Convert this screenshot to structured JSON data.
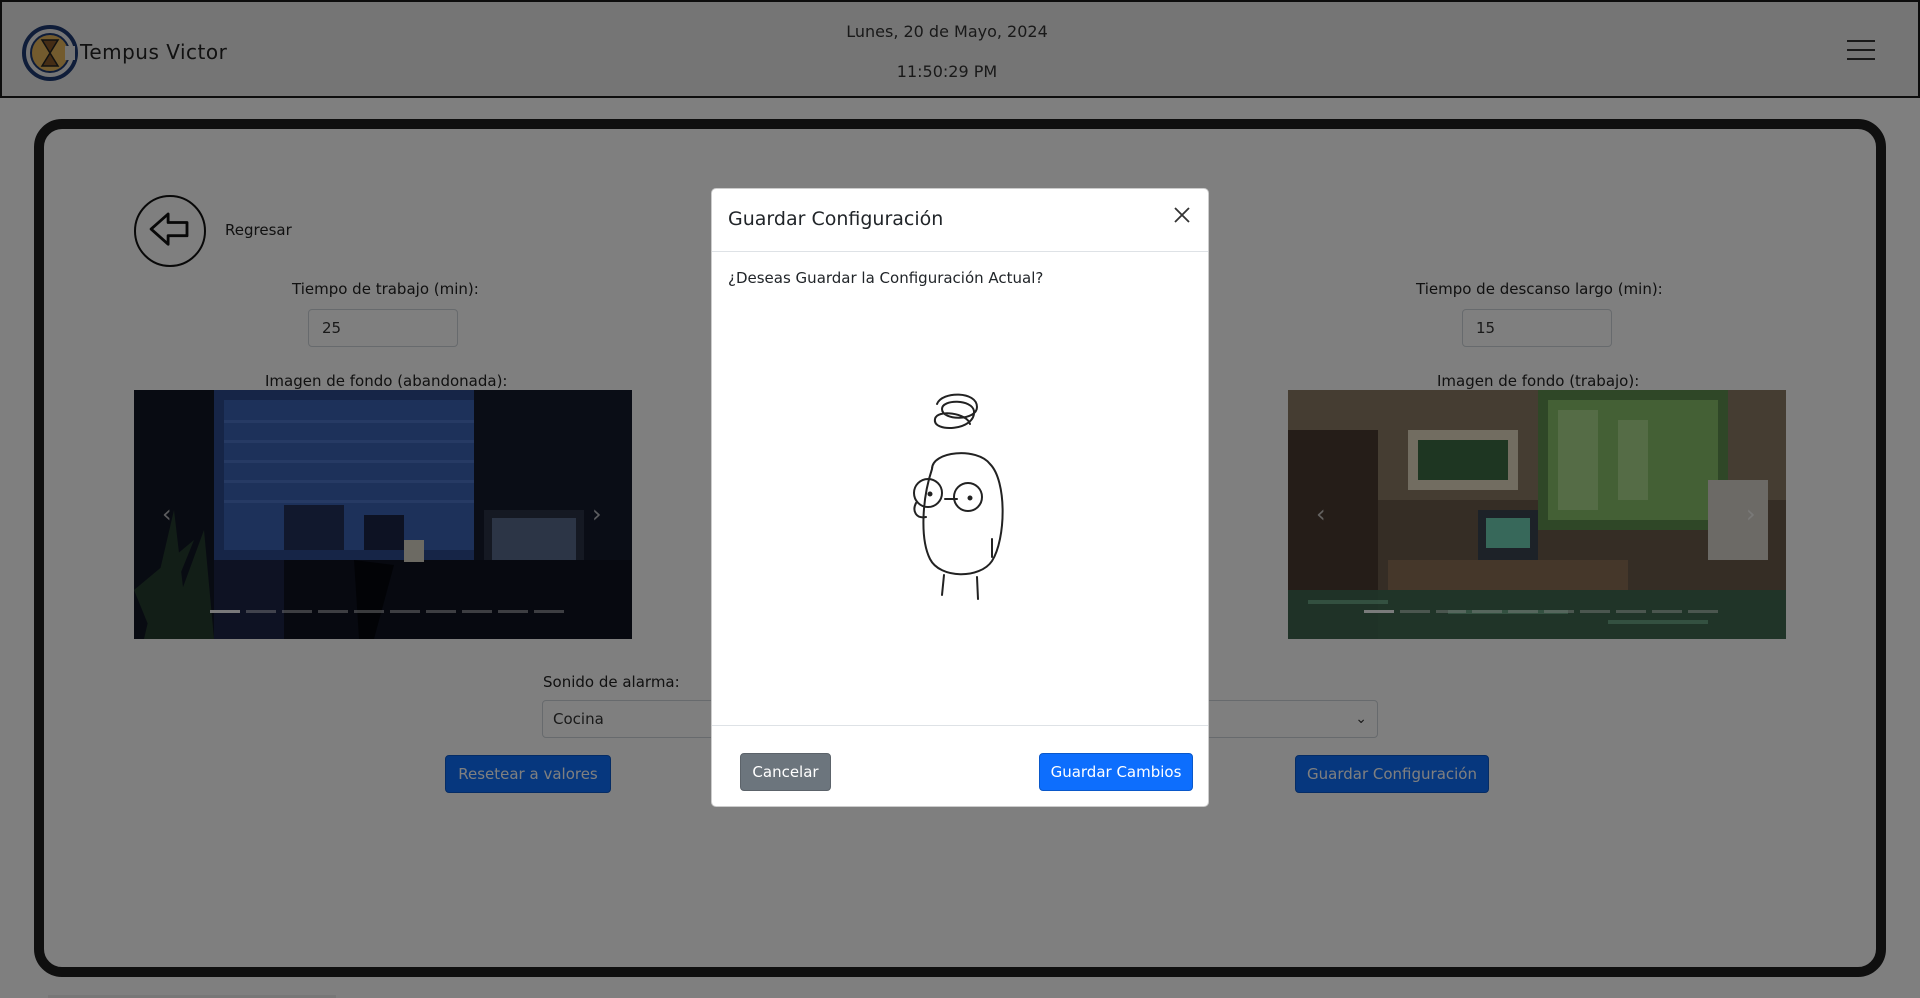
{
  "header": {
    "brand": "Tempus Victor",
    "date": "Lunes, 20 de Mayo, 2024",
    "time": "11:50:29 PM",
    "icons": {
      "logo": "hourglass-clock-logo",
      "menu": "hamburger-menu-icon"
    }
  },
  "settings": {
    "back_label": "Regresar",
    "work_time_label": "Tiempo de trabajo (min):",
    "work_time_value": "25",
    "long_break_label": "Tiempo de descanso largo (min):",
    "long_break_value": "15",
    "bg_abandoned_label": "Imagen de fondo (abandonada):",
    "bg_work_label": "Imagen de fondo (trabajo):",
    "alarm_label": "Sonido de alarma:",
    "alarm_value": "Cocina",
    "reset_button": "Resetear a valores",
    "save_config_button": "Guardar Configuración"
  },
  "modal": {
    "title": "Guardar Configuración",
    "message": "¿Deseas Guardar la Configuración Actual?",
    "cancel_button": "Cancelar",
    "save_button": "Guardar Cambios"
  },
  "colors": {
    "primary": "#0d6efd",
    "secondary": "#6c757d",
    "card_border": "#1e1e1e",
    "backdrop": "rgba(0,0,0,0.5)"
  }
}
